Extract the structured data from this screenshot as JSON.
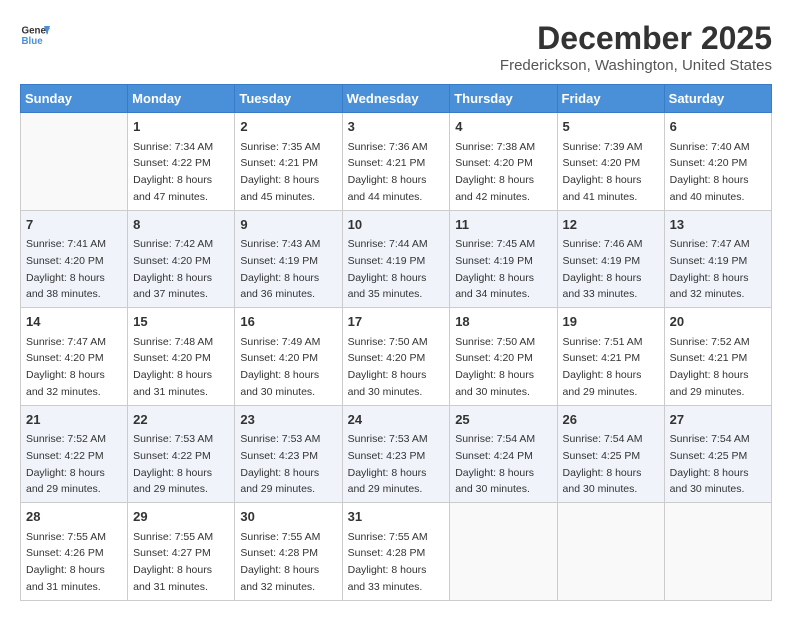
{
  "header": {
    "logo_line1": "General",
    "logo_line2": "Blue",
    "month": "December 2025",
    "location": "Frederickson, Washington, United States"
  },
  "days_of_week": [
    "Sunday",
    "Monday",
    "Tuesday",
    "Wednesday",
    "Thursday",
    "Friday",
    "Saturday"
  ],
  "weeks": [
    [
      {
        "day": "",
        "info": ""
      },
      {
        "day": "1",
        "info": "Sunrise: 7:34 AM\nSunset: 4:22 PM\nDaylight: 8 hours\nand 47 minutes."
      },
      {
        "day": "2",
        "info": "Sunrise: 7:35 AM\nSunset: 4:21 PM\nDaylight: 8 hours\nand 45 minutes."
      },
      {
        "day": "3",
        "info": "Sunrise: 7:36 AM\nSunset: 4:21 PM\nDaylight: 8 hours\nand 44 minutes."
      },
      {
        "day": "4",
        "info": "Sunrise: 7:38 AM\nSunset: 4:20 PM\nDaylight: 8 hours\nand 42 minutes."
      },
      {
        "day": "5",
        "info": "Sunrise: 7:39 AM\nSunset: 4:20 PM\nDaylight: 8 hours\nand 41 minutes."
      },
      {
        "day": "6",
        "info": "Sunrise: 7:40 AM\nSunset: 4:20 PM\nDaylight: 8 hours\nand 40 minutes."
      }
    ],
    [
      {
        "day": "7",
        "info": "Sunrise: 7:41 AM\nSunset: 4:20 PM\nDaylight: 8 hours\nand 38 minutes."
      },
      {
        "day": "8",
        "info": "Sunrise: 7:42 AM\nSunset: 4:20 PM\nDaylight: 8 hours\nand 37 minutes."
      },
      {
        "day": "9",
        "info": "Sunrise: 7:43 AM\nSunset: 4:19 PM\nDaylight: 8 hours\nand 36 minutes."
      },
      {
        "day": "10",
        "info": "Sunrise: 7:44 AM\nSunset: 4:19 PM\nDaylight: 8 hours\nand 35 minutes."
      },
      {
        "day": "11",
        "info": "Sunrise: 7:45 AM\nSunset: 4:19 PM\nDaylight: 8 hours\nand 34 minutes."
      },
      {
        "day": "12",
        "info": "Sunrise: 7:46 AM\nSunset: 4:19 PM\nDaylight: 8 hours\nand 33 minutes."
      },
      {
        "day": "13",
        "info": "Sunrise: 7:47 AM\nSunset: 4:19 PM\nDaylight: 8 hours\nand 32 minutes."
      }
    ],
    [
      {
        "day": "14",
        "info": "Sunrise: 7:47 AM\nSunset: 4:20 PM\nDaylight: 8 hours\nand 32 minutes."
      },
      {
        "day": "15",
        "info": "Sunrise: 7:48 AM\nSunset: 4:20 PM\nDaylight: 8 hours\nand 31 minutes."
      },
      {
        "day": "16",
        "info": "Sunrise: 7:49 AM\nSunset: 4:20 PM\nDaylight: 8 hours\nand 30 minutes."
      },
      {
        "day": "17",
        "info": "Sunrise: 7:50 AM\nSunset: 4:20 PM\nDaylight: 8 hours\nand 30 minutes."
      },
      {
        "day": "18",
        "info": "Sunrise: 7:50 AM\nSunset: 4:20 PM\nDaylight: 8 hours\nand 30 minutes."
      },
      {
        "day": "19",
        "info": "Sunrise: 7:51 AM\nSunset: 4:21 PM\nDaylight: 8 hours\nand 29 minutes."
      },
      {
        "day": "20",
        "info": "Sunrise: 7:52 AM\nSunset: 4:21 PM\nDaylight: 8 hours\nand 29 minutes."
      }
    ],
    [
      {
        "day": "21",
        "info": "Sunrise: 7:52 AM\nSunset: 4:22 PM\nDaylight: 8 hours\nand 29 minutes."
      },
      {
        "day": "22",
        "info": "Sunrise: 7:53 AM\nSunset: 4:22 PM\nDaylight: 8 hours\nand 29 minutes."
      },
      {
        "day": "23",
        "info": "Sunrise: 7:53 AM\nSunset: 4:23 PM\nDaylight: 8 hours\nand 29 minutes."
      },
      {
        "day": "24",
        "info": "Sunrise: 7:53 AM\nSunset: 4:23 PM\nDaylight: 8 hours\nand 29 minutes."
      },
      {
        "day": "25",
        "info": "Sunrise: 7:54 AM\nSunset: 4:24 PM\nDaylight: 8 hours\nand 30 minutes."
      },
      {
        "day": "26",
        "info": "Sunrise: 7:54 AM\nSunset: 4:25 PM\nDaylight: 8 hours\nand 30 minutes."
      },
      {
        "day": "27",
        "info": "Sunrise: 7:54 AM\nSunset: 4:25 PM\nDaylight: 8 hours\nand 30 minutes."
      }
    ],
    [
      {
        "day": "28",
        "info": "Sunrise: 7:55 AM\nSunset: 4:26 PM\nDaylight: 8 hours\nand 31 minutes."
      },
      {
        "day": "29",
        "info": "Sunrise: 7:55 AM\nSunset: 4:27 PM\nDaylight: 8 hours\nand 31 minutes."
      },
      {
        "day": "30",
        "info": "Sunrise: 7:55 AM\nSunset: 4:28 PM\nDaylight: 8 hours\nand 32 minutes."
      },
      {
        "day": "31",
        "info": "Sunrise: 7:55 AM\nSunset: 4:28 PM\nDaylight: 8 hours\nand 33 minutes."
      },
      {
        "day": "",
        "info": ""
      },
      {
        "day": "",
        "info": ""
      },
      {
        "day": "",
        "info": ""
      }
    ]
  ]
}
